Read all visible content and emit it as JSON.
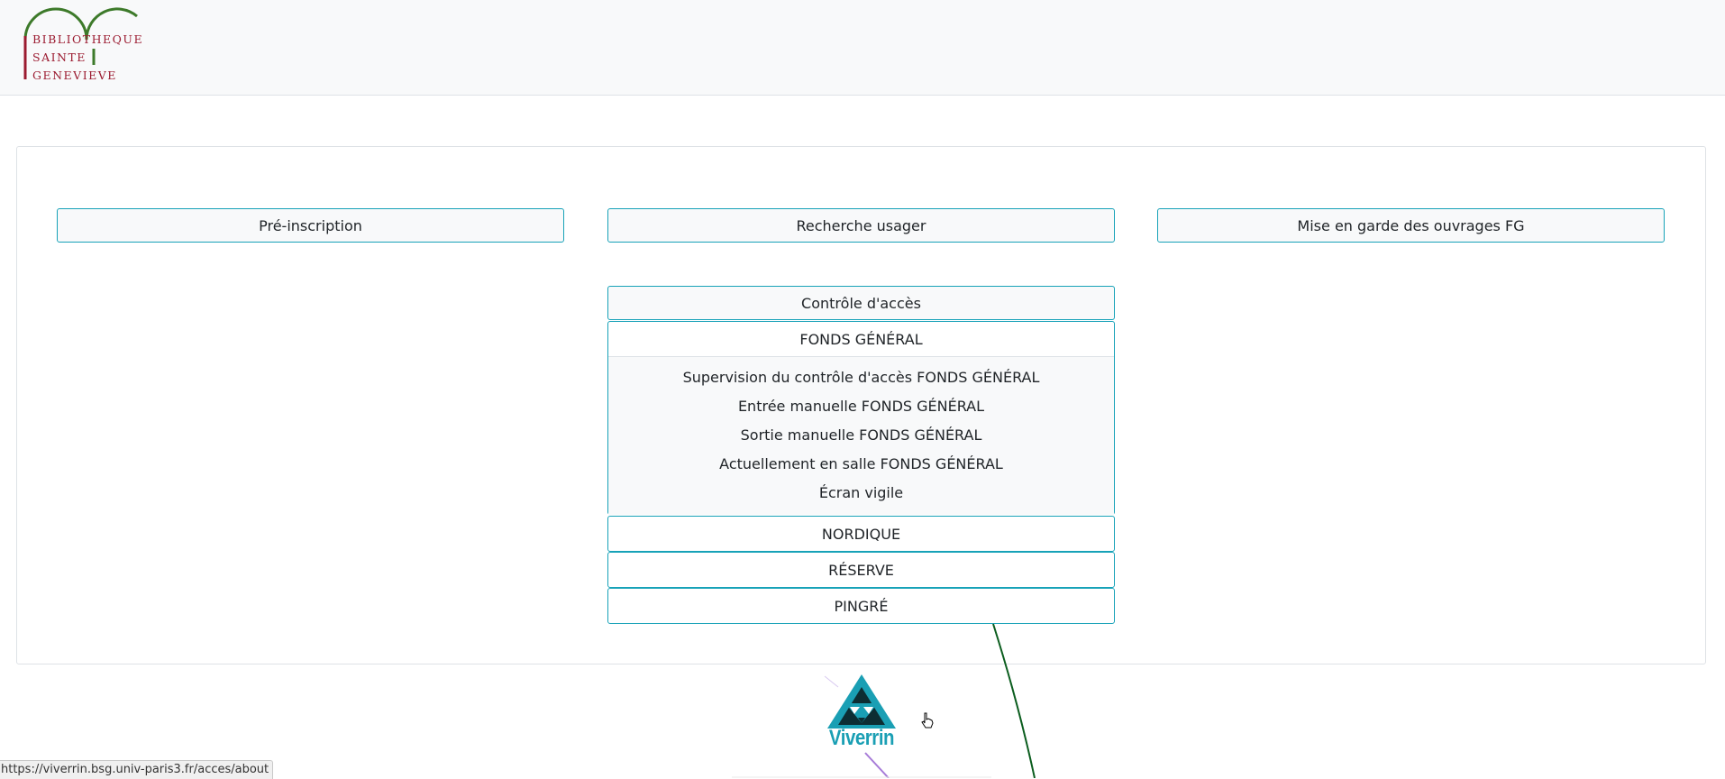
{
  "header": {
    "logo": {
      "line1": "BIBLIOTHEQUE",
      "line2": "SAINTE",
      "line3": "GENEVIEVE"
    }
  },
  "main": {
    "top_buttons": [
      {
        "label": "Pré-inscription"
      },
      {
        "label": "Recherche usager"
      },
      {
        "label": "Mise en garde des ouvrages FG"
      }
    ],
    "access_control": {
      "label": "Contrôle d'accès",
      "sections": {
        "fonds_general": {
          "label": "FONDS GÉNÉRAL",
          "links": [
            {
              "label": "Supervision du contrôle d'accès FONDS GÉNÉRAL"
            },
            {
              "label": "Entrée manuelle FONDS GÉNÉRAL"
            },
            {
              "label": "Sortie manuelle FONDS GÉNÉRAL"
            },
            {
              "label": "Actuellement en salle FONDS GÉNÉRAL"
            },
            {
              "label": "Écran vigile"
            }
          ]
        },
        "nordique": {
          "label": "NORDIQUE"
        },
        "reserve": {
          "label": "RÉSERVE"
        },
        "pingre": {
          "label": "PINGRÉ"
        }
      }
    }
  },
  "footer": {
    "app_name": "Viverrin"
  },
  "status_bar": {
    "url": "https://viverrin.bsg.univ-paris3.fr/acces/about"
  },
  "colors": {
    "accent": "#17a2b8",
    "logo_red": "#9b1b30",
    "logo_green": "#3d7a2a",
    "viverrin_teal": "#1a9fb4"
  },
  "icons": {
    "logo": "library-logo",
    "mascot": "viverrin-logo-icon",
    "cursor": "hand-cursor-icon"
  }
}
